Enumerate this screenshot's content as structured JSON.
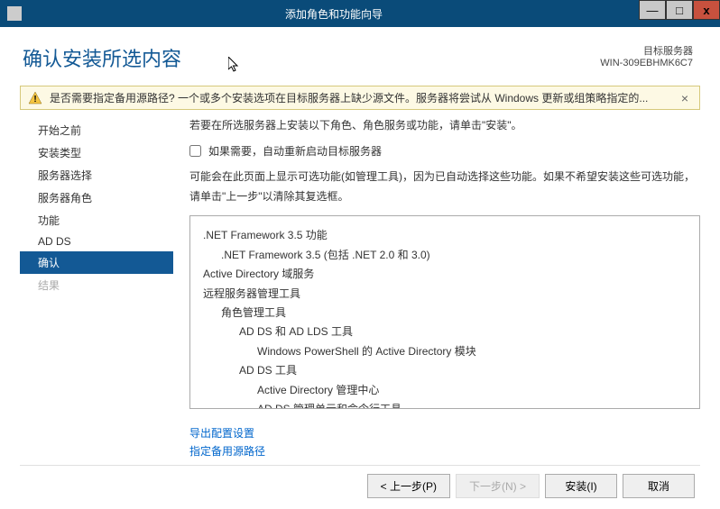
{
  "titlebar": {
    "title": "添加角色和功能向导"
  },
  "header": {
    "pageTitle": "确认安装所选内容",
    "targetServerLabel": "目标服务器",
    "targetServerName": "WIN-309EBHMK6C7"
  },
  "warning": {
    "text": "是否需要指定备用源路径? 一个或多个安装选项在目标服务器上缺少源文件。服务器将尝试从 Windows 更新或组策略指定的..."
  },
  "sidebar": {
    "items": [
      {
        "label": "开始之前",
        "state": "normal"
      },
      {
        "label": "安装类型",
        "state": "normal"
      },
      {
        "label": "服务器选择",
        "state": "normal"
      },
      {
        "label": "服务器角色",
        "state": "normal"
      },
      {
        "label": "功能",
        "state": "normal"
      },
      {
        "label": "AD DS",
        "state": "normal"
      },
      {
        "label": "确认",
        "state": "active"
      },
      {
        "label": "结果",
        "state": "disabled"
      }
    ]
  },
  "main": {
    "instruction": "若要在所选服务器上安装以下角色、角色服务或功能，请单击\"安装\"。",
    "checkboxLabel": "如果需要，自动重新启动目标服务器",
    "note": "可能会在此页面上显示可选功能(如管理工具)，因为已自动选择这些功能。如果不希望安装这些可选功能，请单击\"上一步\"以清除其复选框。",
    "features": [
      {
        "text": ".NET Framework 3.5 功能",
        "indent": 0
      },
      {
        "text": ".NET Framework 3.5 (包括 .NET 2.0 和 3.0)",
        "indent": 1
      },
      {
        "text": "Active Directory 域服务",
        "indent": 0
      },
      {
        "text": "远程服务器管理工具",
        "indent": 0
      },
      {
        "text": "角色管理工具",
        "indent": 1
      },
      {
        "text": "AD DS 和 AD LDS 工具",
        "indent": 2
      },
      {
        "text": "Windows PowerShell 的 Active Directory 模块",
        "indent": 3
      },
      {
        "text": "AD DS 工具",
        "indent": 2
      },
      {
        "text": "Active Directory 管理中心",
        "indent": 3
      },
      {
        "text": "AD DS 管理单元和命令行工具",
        "indent": 3
      }
    ],
    "links": [
      {
        "label": "导出配置设置"
      },
      {
        "label": "指定备用源路径"
      }
    ]
  },
  "buttons": {
    "previous": "< 上一步(P)",
    "next": "下一步(N) >",
    "install": "安装(I)",
    "cancel": "取消"
  }
}
